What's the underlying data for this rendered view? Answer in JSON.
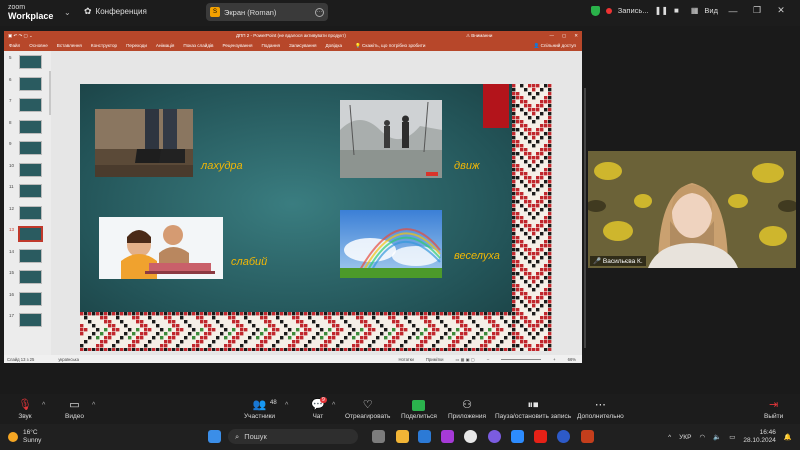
{
  "zoom": {
    "logo_line1": "zoom",
    "logo_line2": "Workplace",
    "conference_label": "Конференция",
    "share_label": "Экран (Roman)",
    "recording_label": "Запись...",
    "view_label": "Вид"
  },
  "powerpoint": {
    "window_title": "ДПП 2 - PowerPoint (не вдалося активувати продукт)",
    "warning": "Вниманни",
    "ribbon_tabs": [
      "Файл",
      "Основне",
      "Вставлення",
      "Конструктор",
      "Переходи",
      "Анімація",
      "Показ слайдів",
      "Рецензування",
      "Подання",
      "Записування",
      "Довідка"
    ],
    "tell_me": "Скажіть, що потрібно зробити",
    "share_button": "Спільний доступ",
    "slide_thumbnails": [
      {
        "num": "5"
      },
      {
        "num": "6"
      },
      {
        "num": "7"
      },
      {
        "num": "8"
      },
      {
        "num": "9"
      },
      {
        "num": "10"
      },
      {
        "num": "11"
      },
      {
        "num": "12"
      },
      {
        "num": "13",
        "active": true
      },
      {
        "num": "14"
      },
      {
        "num": "15"
      },
      {
        "num": "16"
      },
      {
        "num": "17"
      }
    ],
    "status_slide": "Слайд 13 з 25",
    "status_lang": "українська",
    "status_notes": "Нотатки",
    "status_comments": "Примітки",
    "zoom_pct": "66%"
  },
  "slide": {
    "captions": {
      "c1": "лахудра",
      "c2": "движ",
      "c3": "слабий",
      "c4": "веселуха"
    }
  },
  "camera": {
    "participant_name": "Васильєва К."
  },
  "toolbar": {
    "audio": "Звук",
    "video": "Видео",
    "participants": "Участники",
    "participants_count": "48",
    "chat": "Чат",
    "chat_badge": "9",
    "react": "Отреагировать",
    "share": "Поделиться",
    "apps": "Приложения",
    "pause_record": "Пауза/остановить запись",
    "more": "Дополнительно",
    "leave": "Выйти"
  },
  "taskbar": {
    "temperature": "16°C",
    "weather": "Sunny",
    "search_placeholder": "Пошук",
    "lang": "УКР",
    "time": "16:46",
    "date": "28.10.2024"
  },
  "colors": {
    "ppt_accent": "#b7472a",
    "caption_color": "#f2b705",
    "slide_bg": "#2a6266"
  }
}
